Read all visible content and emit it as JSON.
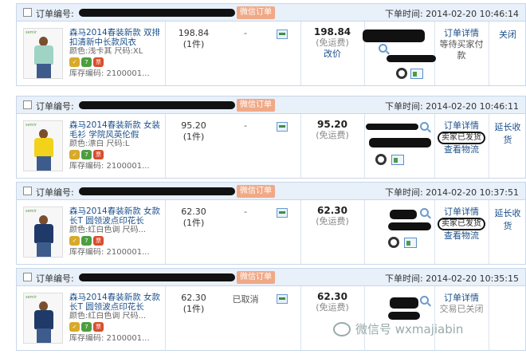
{
  "labels": {
    "order_no": "订单编号:",
    "order_time": "下单时间:",
    "wechat_order": "微信订单",
    "order_detail": "订单详情",
    "free_shipping": "(免运费)",
    "view_logistics": "查看物流",
    "extend_receipt": "延长收货"
  },
  "orders": [
    {
      "time": "2014-02-20 10:46:14",
      "title": "森马2014春装新款 双排扣清新中长款风衣",
      "color_size": "颜色:浅卡其 尺码:XL",
      "stock": "库存编码: 2100001...",
      "unit_price": "198.84",
      "qty": "(1件)",
      "item_status": "-",
      "total": "198.84",
      "price_action": "改价",
      "status_line": "等待买家付款",
      "extra": "关闭",
      "shirt_color": "#9fd3c4"
    },
    {
      "time": "2014-02-20 10:46:11",
      "title": "森马2014春装新款 女装毛衫 学院风英伦假",
      "color_size": "颜色:漂白 尺码:L",
      "stock": "库存编码: 2100001...",
      "unit_price": "95.20",
      "qty": "(1件)",
      "item_status": "-",
      "total": "95.20",
      "status_line": "卖家已发货",
      "extra": "延长收货",
      "shirt_color": "#f2d21b"
    },
    {
      "time": "2014-02-20 10:37:51",
      "title": "森马2014春装新款 女款长T 圆领波点印花长",
      "color_size": "颜色:红白色调 尺码...",
      "stock": "库存编码: 2100001...",
      "unit_price": "62.30",
      "qty": "(1件)",
      "item_status": "-",
      "total": "62.30",
      "status_line": "卖家已发货",
      "extra": "延长收货",
      "shirt_color": "#1f3a68"
    },
    {
      "time": "2014-02-20 10:35:15",
      "title": "森马2014春装新款 女款长T 圆领波点印花长",
      "color_size": "颜色:红白色调 尺码...",
      "stock": "库存编码: 2100001...",
      "unit_price": "62.30",
      "qty": "(1件)",
      "item_status": "已取消",
      "total": "62.30",
      "status_line": "交易已关闭",
      "extra": "",
      "shirt_color": "#1f3a68"
    }
  ],
  "watermark": "微信号 wxmajiabin"
}
